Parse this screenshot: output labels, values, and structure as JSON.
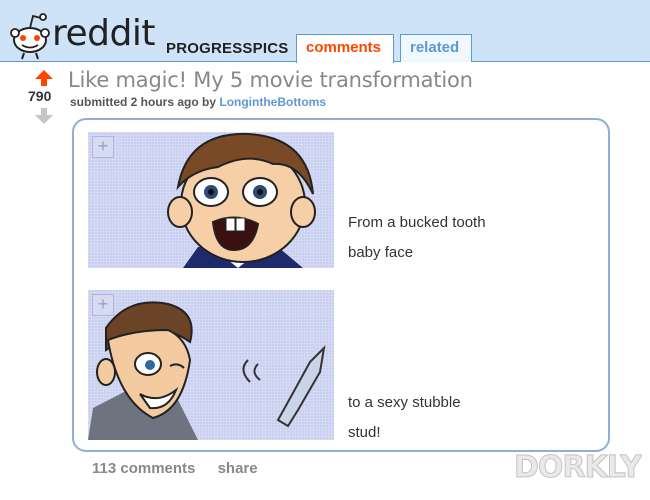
{
  "header": {
    "wordmark": "reddit",
    "subreddit": "PROGRESSPICS",
    "tabs": [
      {
        "label": "comments",
        "active": true
      },
      {
        "label": "related",
        "active": false
      }
    ],
    "colors": {
      "bar": "#cee3f8",
      "active_tab": "#ff4500",
      "tab": "#5f99cf"
    }
  },
  "post": {
    "score": "790",
    "title": "Like magic! My 5 movie transformation",
    "tagline_prefix": "submitted 2 hours ago by ",
    "author": "LongintheBottoms",
    "captions": [
      [
        "From a bucked tooth",
        "baby face"
      ],
      [
        "to a sexy stubble",
        "stud!"
      ]
    ],
    "expando_icon": "+",
    "comments_label": "113 comments",
    "share_label": "share"
  },
  "watermark": {
    "text": "DORKLY",
    "icon": "dorkly-logo"
  }
}
